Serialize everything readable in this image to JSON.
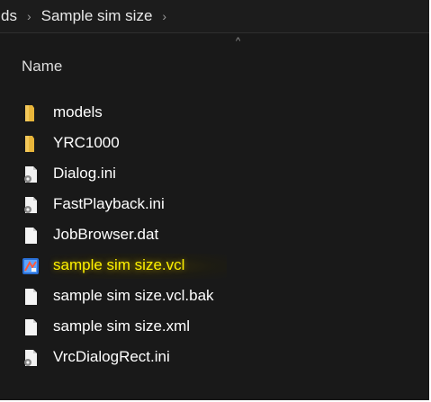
{
  "breadcrumb": {
    "items": [
      "ds",
      "Sample sim size"
    ],
    "separator": "›"
  },
  "column_header": {
    "name_label": "Name",
    "sort_indicator": "^"
  },
  "files": [
    {
      "name": "models",
      "icon": "folder-icon",
      "highlighted": false
    },
    {
      "name": "YRC1000",
      "icon": "folder-icon",
      "highlighted": false
    },
    {
      "name": "Dialog.ini",
      "icon": "config-file-icon",
      "highlighted": false
    },
    {
      "name": "FastPlayback.ini",
      "icon": "config-file-icon",
      "highlighted": false
    },
    {
      "name": "JobBrowser.dat",
      "icon": "blank-file-icon",
      "highlighted": false
    },
    {
      "name": "sample sim size.vcl",
      "icon": "vcl-app-file-icon",
      "highlighted": true
    },
    {
      "name": "sample sim size.vcl.bak",
      "icon": "blank-file-icon",
      "highlighted": false
    },
    {
      "name": "sample sim size.xml",
      "icon": "blank-file-icon",
      "highlighted": false
    },
    {
      "name": "VrcDialogRect.ini",
      "icon": "config-file-icon",
      "highlighted": false
    }
  ],
  "colors": {
    "background": "#191919",
    "folder": "#e8b53a",
    "highlight_text": "#fff200"
  }
}
